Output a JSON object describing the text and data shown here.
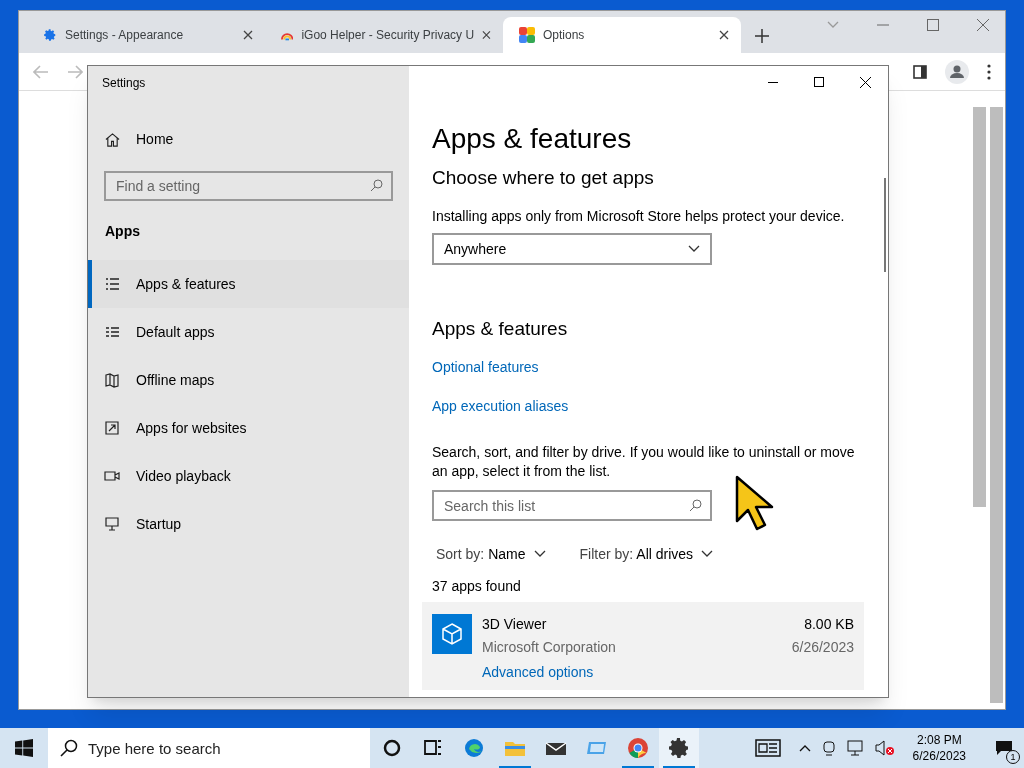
{
  "browser": {
    "tabs": [
      {
        "title": "Settings - Appearance",
        "selected": false
      },
      {
        "title": "iGoo Helper - Security Privacy U",
        "selected": false
      },
      {
        "title": "Options",
        "selected": true
      }
    ]
  },
  "settings_window": {
    "title": "Settings",
    "sidebar": {
      "home": "Home",
      "search_placeholder": "Find a setting",
      "section": "Apps",
      "items": [
        {
          "label": "Apps & features",
          "selected": true
        },
        {
          "label": "Default apps",
          "selected": false
        },
        {
          "label": "Offline maps",
          "selected": false
        },
        {
          "label": "Apps for websites",
          "selected": false
        },
        {
          "label": "Video playback",
          "selected": false
        },
        {
          "label": "Startup",
          "selected": false
        }
      ]
    },
    "content": {
      "title": "Apps & features",
      "source_heading": "Choose where to get apps",
      "source_text": "Installing apps only from Microsoft Store helps protect your device.",
      "source_value": "Anywhere",
      "section_heading": "Apps & features",
      "links": [
        "Optional features",
        "App execution aliases"
      ],
      "search_text": "Search, sort, and filter by drive. If you would like to uninstall or move an app, select it from the list.",
      "search_placeholder": "Search this list",
      "sort_label": "Sort by:",
      "sort_value": "Name",
      "filter_label": "Filter by:",
      "filter_value": "All drives",
      "count": "37 apps found",
      "apps": [
        {
          "name": "3D Viewer",
          "publisher": "Microsoft Corporation",
          "size": "8.00 KB",
          "date": "6/26/2023",
          "link": "Advanced options",
          "selected": true
        }
      ]
    }
  },
  "taskbar": {
    "search_placeholder": "Type here to search",
    "apps": [
      {
        "running": false
      },
      {
        "running": false
      },
      {
        "running": false
      },
      {
        "running": true
      },
      {
        "running": false
      },
      {
        "running": false
      },
      {
        "running": true
      },
      {
        "running": true
      }
    ],
    "time": "2:08 PM",
    "date": "6/26/2023",
    "notifications": "1"
  }
}
